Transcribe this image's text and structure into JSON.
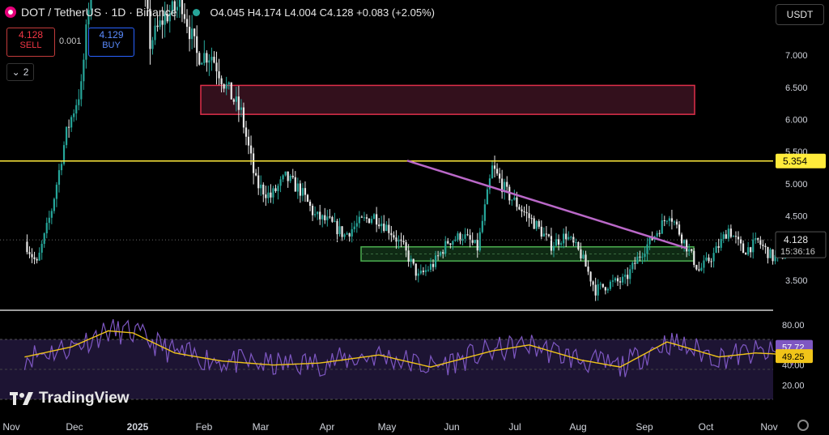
{
  "header": {
    "symbol": "DOT / TetherUS · 1D · Binance",
    "ohlc": "O4.045  H4.174  L4.004  C4.128  +0.083 (+2.05%)"
  },
  "trade": {
    "sell_price": "4.128",
    "sell_label": "SELL",
    "buy_price": "4.129",
    "buy_label": "BUY",
    "spread": "0.001",
    "indicator_count": "2"
  },
  "currency": "USDT",
  "branding": "TradingView",
  "colors": {
    "up": "#26a69a",
    "down": "#e8e8e8",
    "resistance": "#ffeb3b",
    "trendline": "#ba68c8",
    "supply": "#e02f4a",
    "demand": "#4caf50",
    "rsi": "#7e57c2",
    "rsi_ma": "#f0c419"
  },
  "chart_data": [
    {
      "type": "candlestick",
      "ylim": [
        3.05,
        8.0
      ],
      "y_ticks": [
        "3.500",
        "4.000",
        "4.500",
        "5.000",
        "5.500",
        "6.000",
        "6.500",
        "7.000"
      ],
      "x_ticks": [
        "Nov",
        "Dec",
        "2025",
        "Feb",
        "Mar",
        "Apr",
        "May",
        "Jun",
        "Jul",
        "Aug",
        "Sep",
        "Oct",
        "Nov"
      ],
      "last_price": "4.128",
      "countdown": "15:36:16",
      "resistance_level": "5.354",
      "annotations": {
        "horizontal_line": 5.354,
        "supply_zone": [
          6.08,
          6.53
        ],
        "demand_zone": [
          3.8,
          4.02
        ],
        "trendline": [
          [
            5.36,
            "May 10"
          ],
          [
            4.07,
            "Sep 15"
          ]
        ]
      },
      "close_path": [
        [
          "2024-11-01",
          4.1
        ],
        [
          "2024-11-06",
          3.75
        ],
        [
          "2024-11-12",
          4.6
        ],
        [
          "2024-11-18",
          5.8
        ],
        [
          "2024-11-24",
          6.5
        ],
        [
          "2024-11-28",
          8.2
        ],
        [
          "2024-12-04",
          10.5
        ],
        [
          "2024-12-10",
          8.8
        ],
        [
          "2024-12-16",
          9.2
        ],
        [
          "2024-12-22",
          7.2
        ],
        [
          "2024-12-28",
          7.6
        ],
        [
          "2025-01-04",
          7.8
        ],
        [
          "2025-01-10",
          7.0
        ],
        [
          "2025-01-16",
          7.0
        ],
        [
          "2025-01-22",
          6.5
        ],
        [
          "2025-01-28",
          6.1
        ],
        [
          "2025-02-03",
          5.0
        ],
        [
          "2025-02-09",
          4.8
        ],
        [
          "2025-02-15",
          5.1
        ],
        [
          "2025-02-21",
          4.9
        ],
        [
          "2025-02-27",
          4.5
        ],
        [
          "2025-03-05",
          4.4
        ],
        [
          "2025-03-11",
          4.2
        ],
        [
          "2025-03-17",
          4.4
        ],
        [
          "2025-03-23",
          4.5
        ],
        [
          "2025-03-29",
          4.3
        ],
        [
          "2025-04-04",
          4.0
        ],
        [
          "2025-04-10",
          3.55
        ],
        [
          "2025-04-16",
          3.75
        ],
        [
          "2025-04-22",
          4.1
        ],
        [
          "2025-04-28",
          4.2
        ],
        [
          "2025-05-04",
          4.0
        ],
        [
          "2025-05-10",
          5.25
        ],
        [
          "2025-05-16",
          4.85
        ],
        [
          "2025-05-22",
          4.6
        ],
        [
          "2025-05-28",
          4.35
        ],
        [
          "2025-06-03",
          4.05
        ],
        [
          "2025-06-09",
          4.2
        ],
        [
          "2025-06-15",
          3.9
        ],
        [
          "2025-06-21",
          3.35
        ],
        [
          "2025-06-27",
          3.45
        ],
        [
          "2025-07-03",
          3.5
        ],
        [
          "2025-07-09",
          3.9
        ],
        [
          "2025-07-15",
          4.2
        ],
        [
          "2025-07-21",
          4.55
        ],
        [
          "2025-07-27",
          4.1
        ],
        [
          "2025-08-02",
          3.65
        ],
        [
          "2025-08-08",
          3.9
        ],
        [
          "2025-08-14",
          4.3
        ],
        [
          "2025-08-20",
          3.95
        ],
        [
          "2025-08-26",
          4.1
        ],
        [
          "2025-09-01",
          3.85
        ],
        [
          "2025-09-06",
          3.9
        ],
        [
          "2025-09-10",
          4.13
        ]
      ]
    },
    {
      "type": "line",
      "name": "RSI",
      "ylim": [
        15,
        88
      ],
      "y_ticks": [
        "20.00",
        "40.00",
        "80.00"
      ],
      "rsi_value": "57.72",
      "rsi_ma_value": "49.25",
      "rsi_ma_path": [
        [
          "2024-11-01",
          48
        ],
        [
          "2024-11-20",
          58
        ],
        [
          "2024-12-05",
          74
        ],
        [
          "2024-12-15",
          72
        ],
        [
          "2025-01-01",
          52
        ],
        [
          "2025-01-20",
          44
        ],
        [
          "2025-02-10",
          40
        ],
        [
          "2025-03-01",
          42
        ],
        [
          "2025-03-25",
          50
        ],
        [
          "2025-04-15",
          38
        ],
        [
          "2025-05-10",
          54
        ],
        [
          "2025-05-25",
          60
        ],
        [
          "2025-06-15",
          45
        ],
        [
          "2025-07-01",
          38
        ],
        [
          "2025-07-20",
          63
        ],
        [
          "2025-08-10",
          48
        ],
        [
          "2025-08-25",
          52
        ],
        [
          "2025-09-10",
          50
        ]
      ]
    }
  ]
}
